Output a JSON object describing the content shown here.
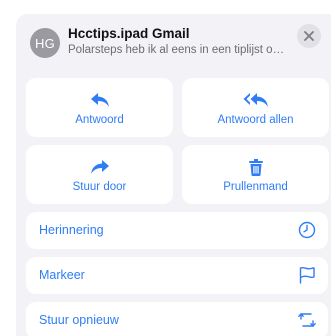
{
  "header": {
    "avatar_initials": "HG",
    "sender": "Hcctips.ipad Gmail",
    "subject": "Polarsteps heb ik al eens in een tiplijst opgen..."
  },
  "actions": {
    "reply": {
      "label": "Antwoord",
      "icon": "reply-icon"
    },
    "reply_all": {
      "label": "Antwoord allen",
      "icon": "reply-all-icon"
    },
    "forward": {
      "label": "Stuur door",
      "icon": "forward-icon"
    },
    "trash": {
      "label": "Prullenmand",
      "icon": "trash-icon"
    }
  },
  "list": {
    "reminder": {
      "label": "Herinnering",
      "icon": "clock-icon"
    },
    "flag": {
      "label": "Markeer",
      "icon": "flag-icon"
    },
    "resend": {
      "label": "Stuur opnieuw",
      "icon": "resend-icon"
    }
  },
  "colors": {
    "accent": "#2f7df6",
    "sheet_background": "#f2f2f7",
    "avatar": "#9a9aa0"
  }
}
